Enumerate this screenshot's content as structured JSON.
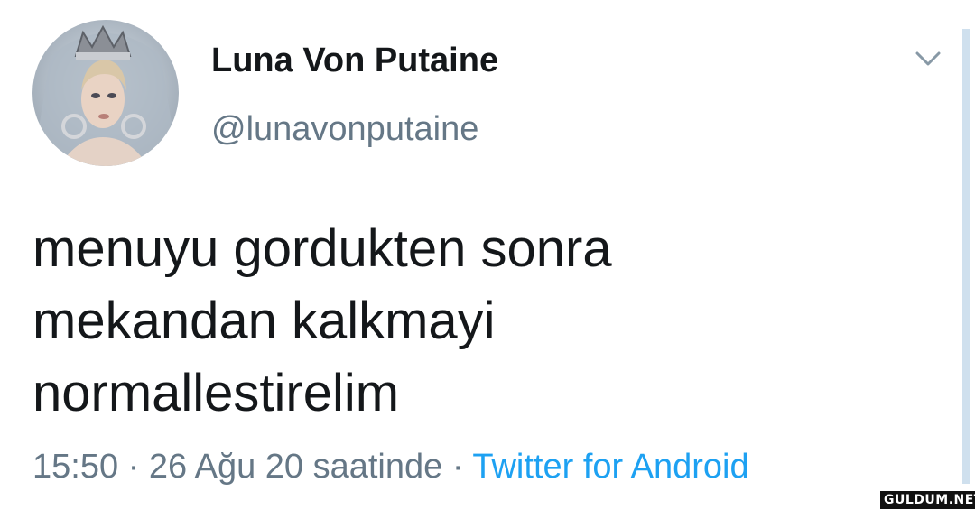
{
  "tweet": {
    "author": {
      "display_name": "Luna Von Putaine",
      "handle": "@lunavonputaine",
      "avatar_icon": "profile-photo"
    },
    "text_lines": [
      "menuyu gordukten sonra",
      "mekandan kalkmayi",
      "normallestirelim"
    ],
    "meta": {
      "time": "15:50",
      "separator": "·",
      "date_phrase": "26 Ağu 20 saatinde",
      "source": "Twitter for Android"
    },
    "menu_icon": "chevron-down-icon"
  },
  "watermark": "GULDUM.NET",
  "colors": {
    "primary_text": "#14171a",
    "secondary_text": "#657786",
    "link": "#1da1f2",
    "background": "#ffffff"
  }
}
